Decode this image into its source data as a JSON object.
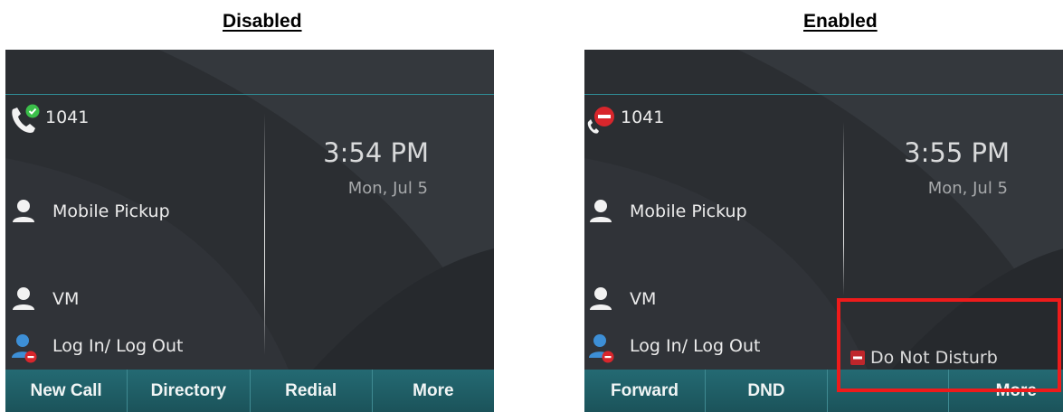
{
  "panels": [
    {
      "caption": "Disabled",
      "lines": [
        {
          "label": "1041",
          "icon": "phone-registered-icon"
        },
        {
          "label": "Mobile Pickup",
          "icon": "person-icon"
        },
        {
          "label": "VM",
          "icon": "person-icon"
        },
        {
          "label": "Log In/ Log Out",
          "icon": "person-blocked-icon"
        }
      ],
      "time": "3:54 PM",
      "date": "Mon, Jul 5",
      "softkeys": [
        "New Call",
        "Directory",
        "Redial",
        "More"
      ]
    },
    {
      "caption": "Enabled",
      "lines": [
        {
          "label": "1041",
          "icon": "phone-dnd-icon"
        },
        {
          "label": "Mobile Pickup",
          "icon": "person-icon"
        },
        {
          "label": "VM",
          "icon": "person-icon"
        },
        {
          "label": "Log In/ Log Out",
          "icon": "person-blocked-icon"
        }
      ],
      "time": "3:55 PM",
      "date": "Mon, Jul 5",
      "status_text": "Do Not Disturb",
      "softkeys": [
        "Forward",
        "DND",
        "",
        "More"
      ]
    }
  ],
  "colors": {
    "screen_bg": "#2c2f33",
    "softkey_bar": "#1f5d65",
    "highlight": "#ee1b1b",
    "registered_green": "#3bbf4a",
    "dnd_red": "#d8262c"
  }
}
